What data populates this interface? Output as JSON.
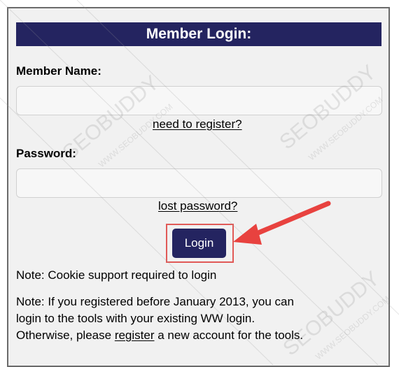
{
  "login_panel": {
    "title": "Member Login:",
    "member_name_label": "Member Name:",
    "member_name_value": "",
    "need_register_link": "need to register?",
    "password_label": "Password:",
    "password_value": "",
    "lost_password_link": "lost password?",
    "login_button": "Login",
    "note_cookie": "Note: Cookie support required to login",
    "note_registered_line1": "Note: If you registered before January 2013, you can",
    "note_registered_line2": "login to the tools with your existing WW login.",
    "note_registered_prefix": "Otherwise, please",
    "register_link": "register",
    "note_registered_suffix": "a new account for the tools."
  },
  "watermark": {
    "text": "SEOBUDDY",
    "subtext": "WWW.SEOBUDDY.COM"
  },
  "colors": {
    "header_bg": "#242460",
    "button_bg": "#242460",
    "highlight_border": "#e15a57",
    "arrow": "#e8423f",
    "panel_bg": "#f1f1f1"
  }
}
